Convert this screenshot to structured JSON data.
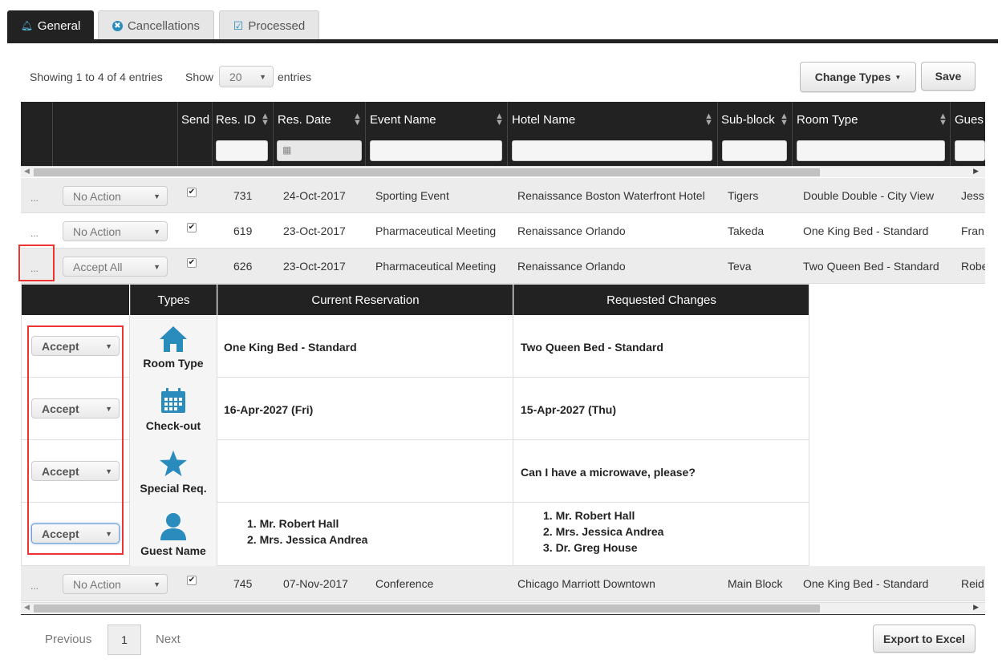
{
  "tabs": [
    {
      "label": "General",
      "icon": "bell-icon"
    },
    {
      "label": "Cancellations",
      "icon": "x-circle-icon"
    },
    {
      "label": "Processed",
      "icon": "check-square-icon"
    }
  ],
  "info": {
    "showing": "Showing 1 to 4 of 4 entries",
    "show": "Show",
    "page_size": "20",
    "entries": "entries"
  },
  "toolbar": {
    "change_types": "Change Types",
    "save": "Save",
    "export": "Export to Excel"
  },
  "columns": [
    "Send",
    "Res. ID",
    "Res. Date",
    "Event Name",
    "Hotel Name",
    "Sub-block",
    "Room Type",
    "Gues"
  ],
  "rows": [
    {
      "action": "No Action",
      "id": "731",
      "date": "24-Oct-2017",
      "event": "Sporting Event",
      "hotel": "Renaissance Boston Waterfront Hotel",
      "sub": "Tigers",
      "room": "Double Double - City View",
      "guest": "Jess"
    },
    {
      "action": "No Action",
      "id": "619",
      "date": "23-Oct-2017",
      "event": "Pharmaceutical Meeting",
      "hotel": "Renaissance Orlando",
      "sub": "Takeda",
      "room": "One King Bed - Standard",
      "guest": "Fran"
    },
    {
      "action": "Accept All",
      "id": "626",
      "date": "23-Oct-2017",
      "event": "Pharmaceutical Meeting",
      "hotel": "Renaissance Orlando",
      "sub": "Teva",
      "room": "Two Queen Bed - Standard",
      "guest": "Robe"
    },
    {
      "action": "No Action",
      "id": "745",
      "date": "07-Nov-2017",
      "event": "Conference",
      "hotel": "Chicago Marriott Downtown",
      "sub": "Main Block",
      "room": "One King Bed - Standard",
      "guest": "Reid"
    }
  ],
  "dots": "...",
  "detail": {
    "headers": {
      "types": "Types",
      "current": "Current Reservation",
      "requested": "Requested Changes"
    },
    "rows": [
      {
        "action": "Accept",
        "type": "Room Type",
        "icon": "home-icon",
        "current": "One King Bed - Standard",
        "requested": "Two Queen Bed - Standard"
      },
      {
        "action": "Accept",
        "type": "Check-out",
        "icon": "calendar-icon",
        "current": "16-Apr-2027 (Fri)",
        "requested": "15-Apr-2027 (Thu)"
      },
      {
        "action": "Accept",
        "type": "Special Req.",
        "icon": "star-icon",
        "current": "",
        "requested": "Can I have a microwave, please?"
      },
      {
        "action": "Accept",
        "type": "Guest Name",
        "icon": "user-icon",
        "current_list": [
          "1. Mr. Robert Hall",
          "2. Mrs. Jessica Andrea"
        ],
        "requested_list": [
          "1. Mr. Robert Hall",
          "2. Mrs. Jessica Andrea",
          "3. Dr. Greg House"
        ]
      }
    ]
  },
  "pagination": {
    "previous": "Previous",
    "page": "1",
    "next": "Next"
  },
  "colors": {
    "accent": "#2a8bbd",
    "header": "#222222",
    "highlight": "#e33333"
  }
}
